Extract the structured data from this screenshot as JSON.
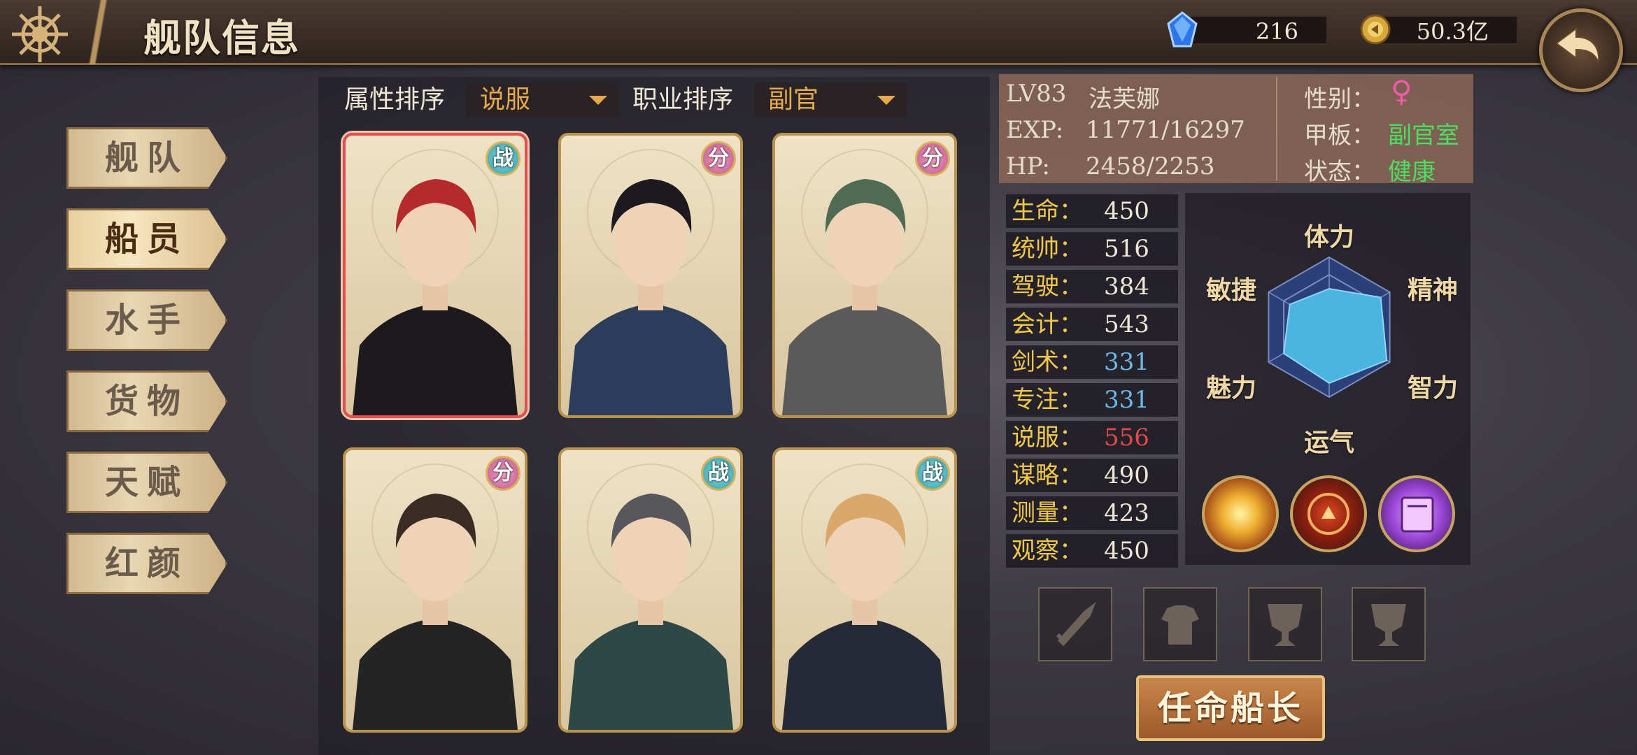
{
  "header": {
    "title": "舰队信息",
    "gems": "216",
    "coins": "50.3亿"
  },
  "menu": [
    "舰队",
    "船员",
    "水手",
    "货物",
    "天赋",
    "红颜"
  ],
  "sort": {
    "attr_label": "属性排序",
    "attr_value": "说服",
    "job_label": "职业排序",
    "job_value": "副官"
  },
  "cards": [
    {
      "badge": "战",
      "hair": "#b52a2a",
      "outfit": "#1c1a1c"
    },
    {
      "badge": "分",
      "hair": "#1c1a1f",
      "outfit": "#2a3e5c"
    },
    {
      "badge": "分",
      "hair": "#4f6b52",
      "outfit": "#5a5a5a"
    },
    {
      "badge": "分",
      "hair": "#3a2c25",
      "outfit": "#242424"
    },
    {
      "badge": "战",
      "hair": "#58585c",
      "outfit": "#2e4848"
    },
    {
      "badge": "战",
      "hair": "#d9a86a",
      "outfit": "#262a36"
    }
  ],
  "info": {
    "level": "LV83",
    "name": "法芙娜",
    "exp_label": "EXP:",
    "exp": "11771/16297",
    "hp_label": "HP:",
    "hp": "2458/2253",
    "gender_label": "性别：",
    "gender_symbol": "♀",
    "deck_label": "甲板：",
    "deck": "副官室",
    "status_label": "状态：",
    "status": "健康"
  },
  "stats": [
    {
      "name": "生命：",
      "value": "450",
      "color": "#f0e6d6"
    },
    {
      "name": "统帅：",
      "value": "516",
      "color": "#f0e6d6"
    },
    {
      "name": "驾驶：",
      "value": "384",
      "color": "#f0e6d6"
    },
    {
      "name": "会计：",
      "value": "543",
      "color": "#f0e6d6"
    },
    {
      "name": "剑术：",
      "value": "331",
      "color": "#6fb8e6"
    },
    {
      "name": "专注：",
      "value": "331",
      "color": "#6fb8e6"
    },
    {
      "name": "说服：",
      "value": "556",
      "color": "#e04a4a"
    },
    {
      "name": "谋略：",
      "value": "490",
      "color": "#f0e6d6"
    },
    {
      "name": "测量：",
      "value": "423",
      "color": "#f0e6d6"
    },
    {
      "name": "观察：",
      "value": "450",
      "color": "#f0e6d6"
    }
  ],
  "radar": {
    "labels": [
      "体力",
      "精神",
      "智力",
      "运气",
      "魅力",
      "敏捷"
    ],
    "values": [
      0.55,
      0.85,
      0.95,
      0.8,
      0.75,
      0.65
    ]
  },
  "appoint_label": "任命船长"
}
